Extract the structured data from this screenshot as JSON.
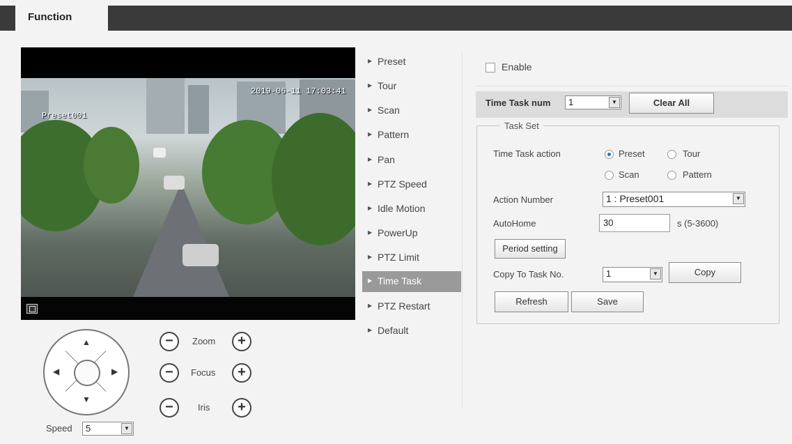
{
  "header": {
    "tab_label": "Function"
  },
  "video": {
    "osd_preset": "Preset001",
    "osd_datetime": "2019-06-11 17:03:41"
  },
  "ptz": {
    "zoom_label": "Zoom",
    "focus_label": "Focus",
    "iris_label": "Iris",
    "minus": "−",
    "plus": "+",
    "speed_label": "Speed",
    "speed_value": "5"
  },
  "menu": {
    "items": [
      {
        "label": "Preset"
      },
      {
        "label": "Tour"
      },
      {
        "label": "Scan"
      },
      {
        "label": "Pattern"
      },
      {
        "label": "Pan"
      },
      {
        "label": "PTZ Speed"
      },
      {
        "label": "Idle Motion"
      },
      {
        "label": "PowerUp"
      },
      {
        "label": "PTZ Limit"
      },
      {
        "label": "Time Task"
      },
      {
        "label": "PTZ Restart"
      },
      {
        "label": "Default"
      }
    ],
    "active": "Time Task"
  },
  "panel": {
    "enable_label": "Enable",
    "enable_checked": false,
    "time_task_num_label": "Time Task num",
    "time_task_num_value": "1",
    "clear_all_label": "Clear All",
    "task_set_legend": "Task Set",
    "time_task_action_label": "Time Task action",
    "actions": {
      "preset": "Preset",
      "tour": "Tour",
      "scan": "Scan",
      "pattern": "Pattern"
    },
    "selected_action": "Preset",
    "action_number_label": "Action Number",
    "action_number_value": "1 : Preset001",
    "autohome_label": "AutoHome",
    "autohome_value": "30",
    "autohome_unit": "s (5-3600)",
    "period_setting_label": "Period setting",
    "copy_to_label": "Copy To Task No.",
    "copy_to_value": "1",
    "copy_label": "Copy",
    "refresh_label": "Refresh",
    "save_label": "Save"
  }
}
